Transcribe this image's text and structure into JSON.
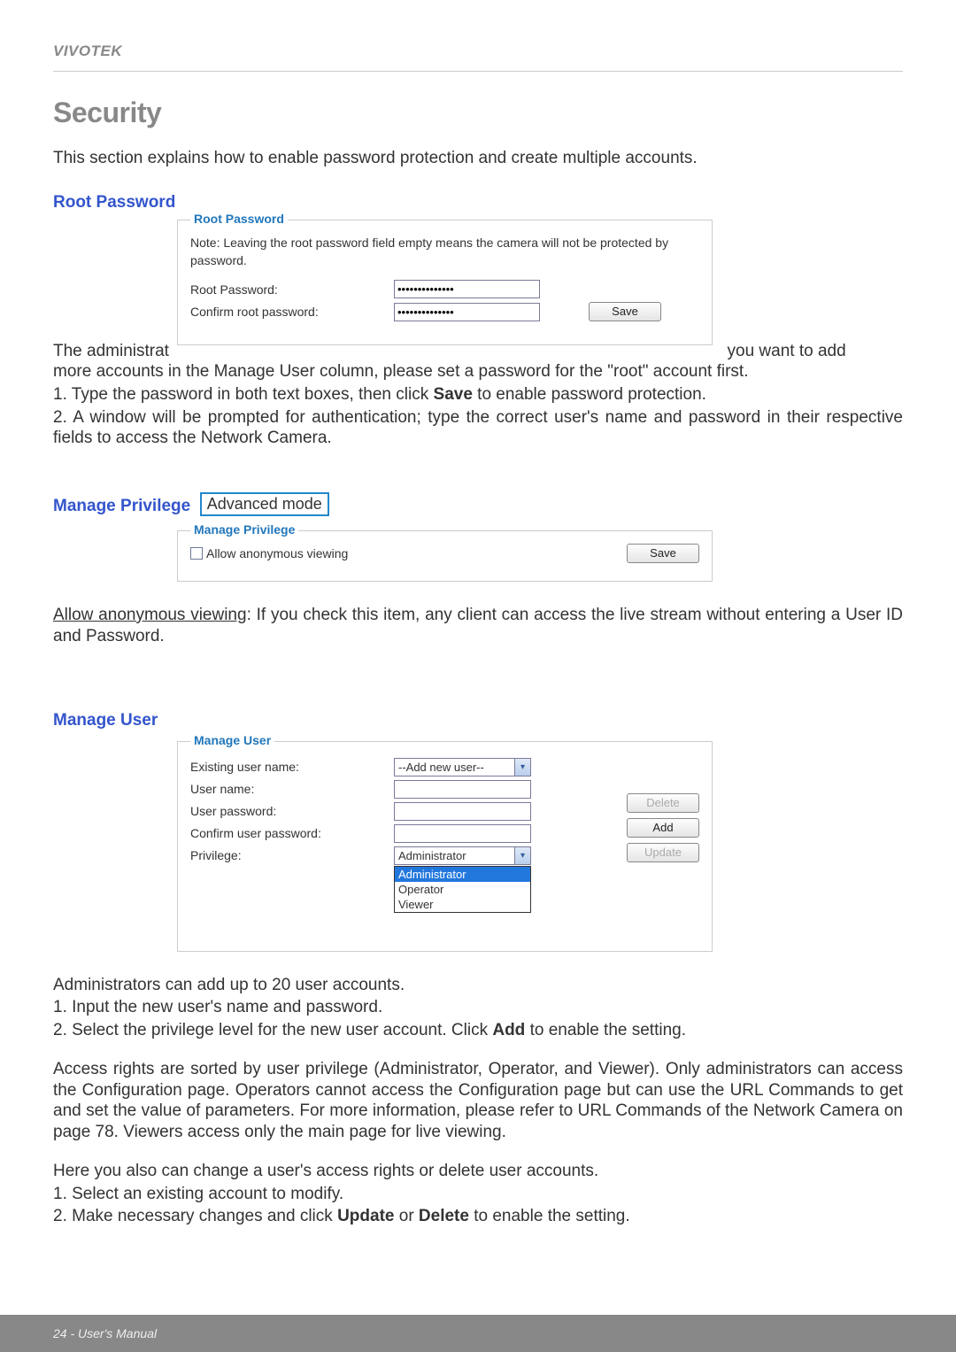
{
  "brand": "VIVOTEK",
  "page": {
    "title": "Security",
    "intro": "This section explains how to enable password protection and create multiple accounts."
  },
  "sections": {
    "root_password": {
      "heading": "Root Password",
      "legend": "Root Password",
      "note": "Note: Leaving the root password field empty means the camera will not be protected by password.",
      "root_pw_label": "Root Password:",
      "confirm_pw_label": "Confirm root password:",
      "root_pw_value": "••••••••••••••",
      "confirm_pw_value": "••••••••••••••",
      "save": "Save",
      "body1_prefix": "The administrat",
      "body1_suffix": "you want to add",
      "body2": "more accounts in the Manage User column, please set a password for the \"root\" account first.",
      "step1": "1. Type the password in both text boxes, then click ",
      "step1_bold": "Save",
      "step1_tail": " to enable password protection.",
      "step2": "2. A window will be prompted for authentication; type the correct user's name and password in their respective fields to access the Network Camera."
    },
    "manage_privilege": {
      "heading": "Manage Privilege",
      "advanced": "Advanced mode",
      "legend": "Manage Privilege",
      "anon_label": "Allow anonymous viewing",
      "save": "Save",
      "body_u": "Allow anonymous viewing",
      "body_tail": ": If you check this item, any client can access the live stream without entering a User ID and Password."
    },
    "manage_user": {
      "heading": "Manage User",
      "legend": "Manage User",
      "existing_label": "Existing user name:",
      "existing_value": "--Add new user--",
      "username_label": "User name:",
      "userpw_label": "User password:",
      "confirm_userpw_label": "Confirm user password:",
      "privilege_label": "Privilege:",
      "privilege_value": "Administrator",
      "options": {
        "administrator": "Administrator",
        "operator": "Operator",
        "viewer": "Viewer"
      },
      "delete": "Delete",
      "add": "Add",
      "update": "Update",
      "body1": "Administrators can add up to 20 user accounts.",
      "body2": "1. Input the new user's name and password.",
      "body3a": "2. Select the privilege level for the new user account. Click ",
      "body3b": "Add",
      "body3c": " to enable the setting.",
      "body4": "Access rights are sorted by user privilege (Administrator, Operator, and Viewer). Only administrators can access the Configuration page. Operators cannot access the Configuration page but can use the URL Commands to get and set the value of parameters. For more information, please refer to URL Commands of the Network Camera on page 78.  Viewers access only the main page for live viewing.",
      "body5": "Here you also can change a user's access rights or delete user accounts.",
      "body6": "1. Select an existing account to modify.",
      "body7a": "2. Make necessary changes and click ",
      "body7b": "Update",
      "body7c": " or ",
      "body7d": "Delete",
      "body7e": " to enable the setting."
    }
  },
  "footer": "24 - User's Manual"
}
